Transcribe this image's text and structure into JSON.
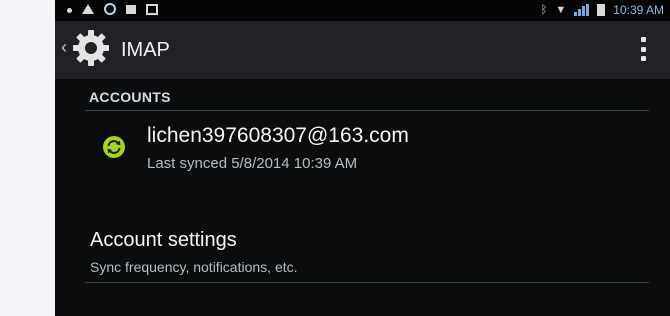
{
  "status_bar": {
    "time": "10:39 AM"
  },
  "action_bar": {
    "title": "IMAP"
  },
  "accounts_section": {
    "header": "ACCOUNTS",
    "account": {
      "email": "lichen397608307@163.com",
      "last_synced": "Last synced 5/8/2014 10:39 AM"
    }
  },
  "settings_item": {
    "title": "Account settings",
    "subtitle": "Sync frequency, notifications, etc."
  },
  "colors": {
    "background": "#0b0c0e",
    "action_bar": "#202226",
    "accent_green": "#a5d425"
  }
}
